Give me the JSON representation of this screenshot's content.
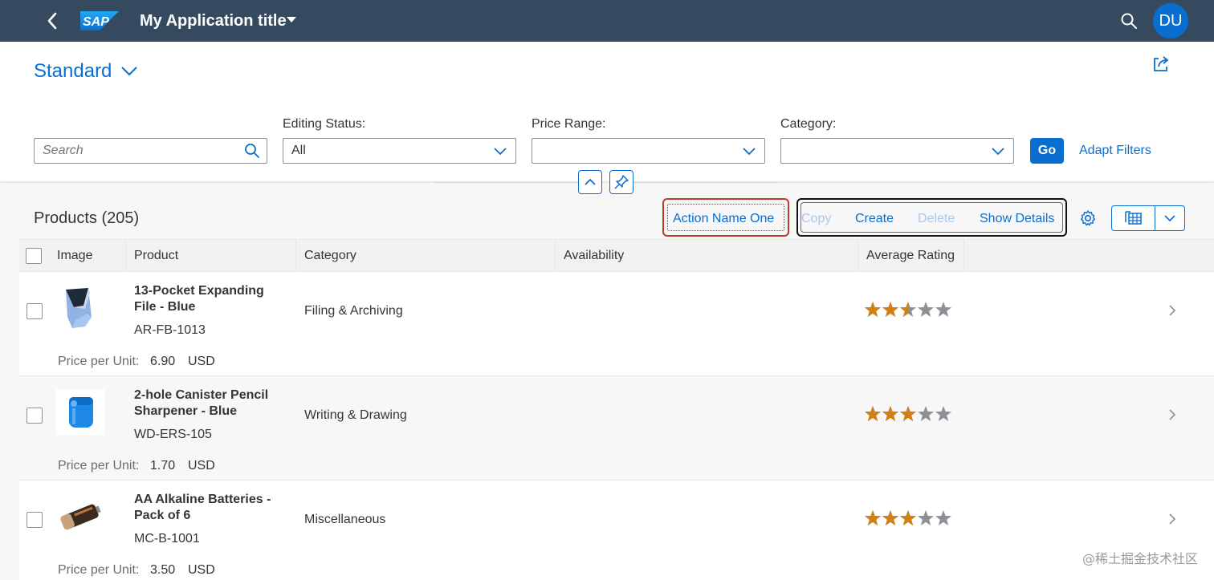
{
  "shell": {
    "title": "My Application title",
    "avatar": "DU",
    "logo": "SAP"
  },
  "header": {
    "variant": "Standard",
    "search_placeholder": "Search",
    "filters": [
      {
        "label": "Editing Status:",
        "value": "All"
      },
      {
        "label": "Price Range:",
        "value": ""
      },
      {
        "label": "Category:",
        "value": ""
      }
    ],
    "go_label": "Go",
    "adapt_label": "Adapt Filters"
  },
  "toolbar": {
    "title": "Products (205)",
    "action_one": "Action Name One",
    "copy": "Copy",
    "create": "Create",
    "delete": "Delete",
    "show_details": "Show Details"
  },
  "table": {
    "columns": [
      "Image",
      "Product",
      "Category",
      "Availability",
      "Average Rating"
    ],
    "price_label": "Price per Unit:",
    "rows": [
      {
        "name": "13-Pocket Expanding File - Blue",
        "id": "AR-FB-1013",
        "category": "Filing & Archiving",
        "price": "6.90",
        "currency": "USD",
        "rating": 2.5,
        "thumb": "file-folder"
      },
      {
        "name": "2-hole Canister Pencil Sharpener - Blue",
        "id": "WD-ERS-105",
        "category": "Writing & Drawing",
        "price": "1.70",
        "currency": "USD",
        "rating": 3,
        "thumb": "pencil-sharpener"
      },
      {
        "name": "AA Alkaline Batteries - Pack of 6",
        "id": "MC-B-1001",
        "category": "Miscellaneous",
        "price": "3.50",
        "currency": "USD",
        "rating": 3,
        "thumb": "battery"
      }
    ]
  },
  "watermark": "@稀土掘金技术社区",
  "colors": {
    "shell": "#354a5f",
    "brand": "#0a6ed1",
    "star_filled": "#d08014",
    "star_empty": "#8d9196"
  }
}
